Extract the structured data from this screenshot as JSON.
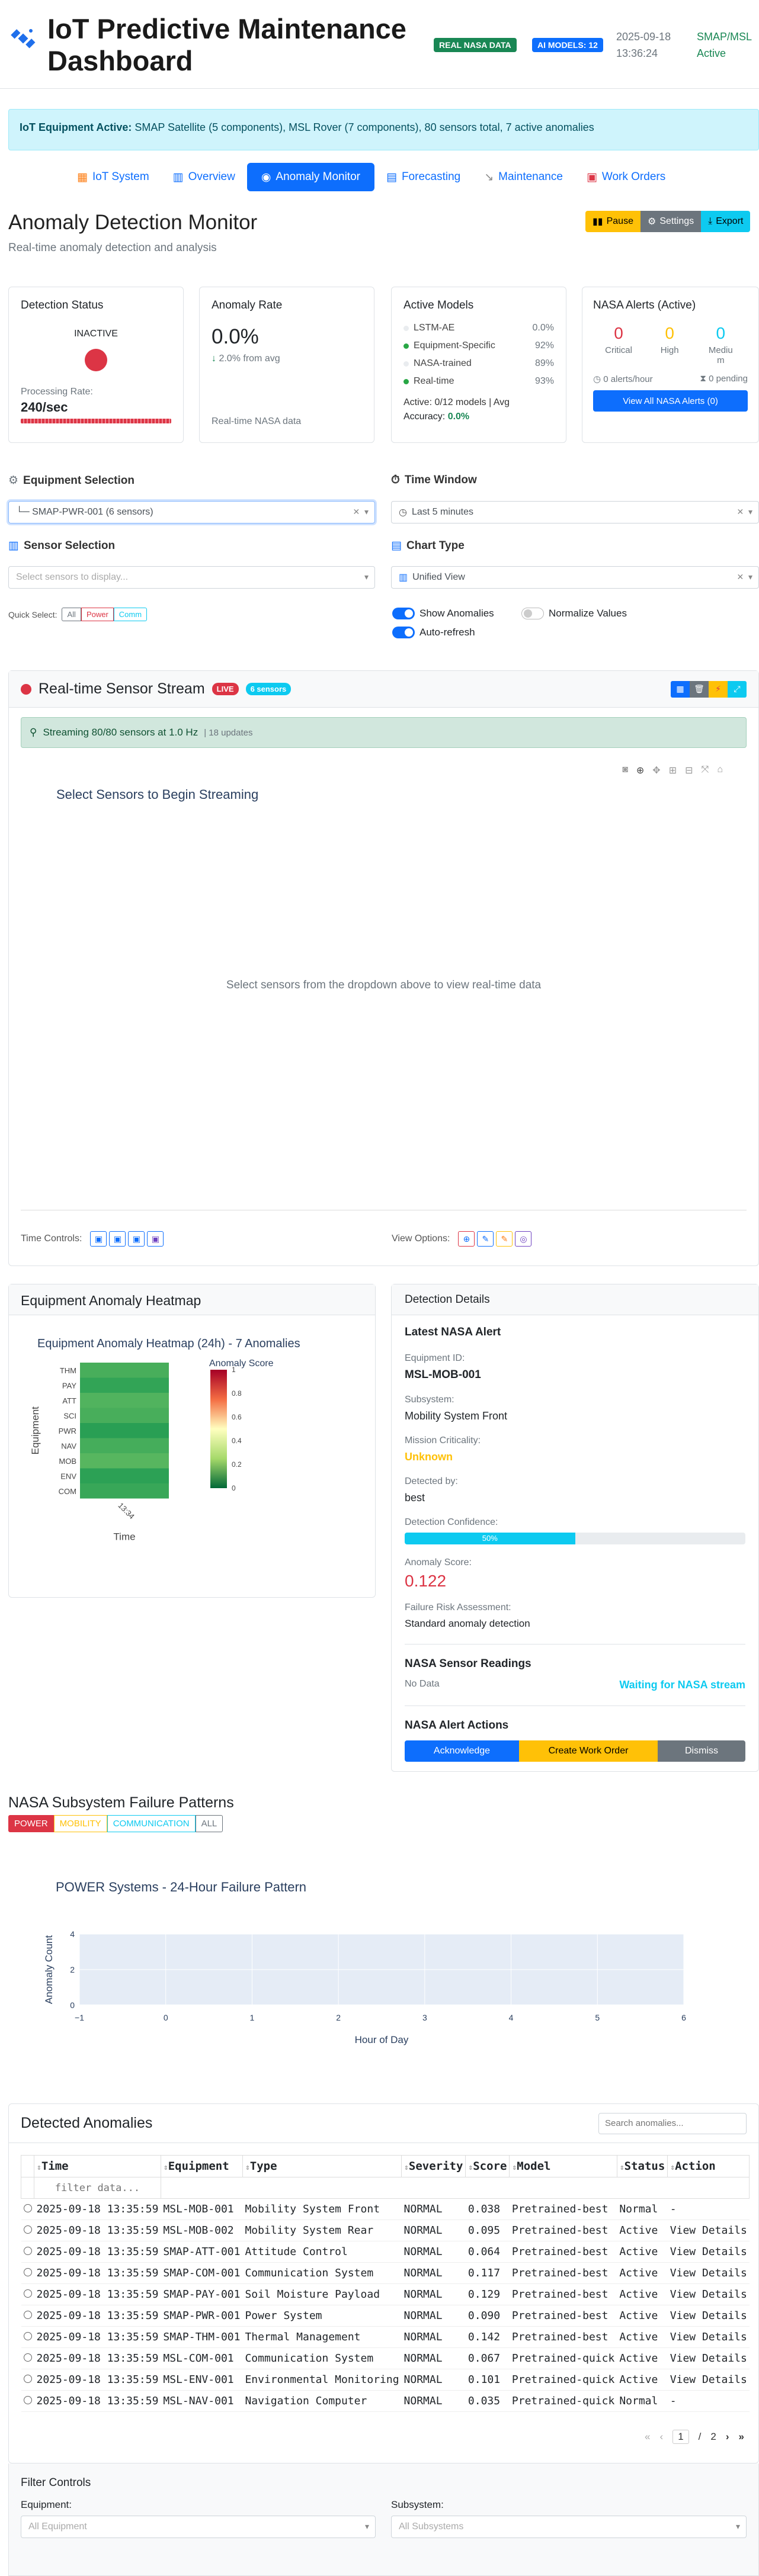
{
  "header": {
    "title_line1": "IoT Predictive Maintenance",
    "title_line2": "Dashboard",
    "badge_real": "REAL NASA DATA",
    "badge_ai": "AI MODELS: 12",
    "date": "2025-09-18",
    "time": "13:36:24",
    "status_line1": "SMAP/MSL",
    "status_line2": "Active"
  },
  "banner": {
    "label": "IoT Equipment Active:",
    "text": " SMAP Satellite (5 components), MSL Rover (7 components), 80 sensors total, 7 active anomalies"
  },
  "nav": {
    "tabs": [
      "IoT System",
      "Overview",
      "Anomaly Monitor",
      "Forecasting",
      "Maintenance",
      "Work Orders"
    ]
  },
  "page": {
    "title": "Anomaly Detection Monitor",
    "subtitle": "Real-time anomaly detection and analysis",
    "pause": "Pause",
    "settings": "Settings",
    "export": "Export"
  },
  "status_cards": {
    "detection": {
      "title": "Detection Status",
      "state": "INACTIVE",
      "rate_label": "Processing Rate:",
      "rate_value": "240/sec"
    },
    "anomaly_rate": {
      "title": "Anomaly Rate",
      "value": "0.0%",
      "delta": "2.0% from avg",
      "footer": "Real-time NASA data"
    },
    "models": {
      "title": "Active Models",
      "items": [
        {
          "name": "LSTM-AE",
          "value": "0.0%",
          "color": "#e9ecef"
        },
        {
          "name": "Equipment-Specific",
          "value": "92%",
          "color": "#28a745"
        },
        {
          "name": "NASA-trained",
          "value": "89%",
          "color": "#e9ecef"
        },
        {
          "name": "Real-time",
          "value": "93%",
          "color": "#28a745"
        }
      ],
      "active_text": "Active: 0/12 models | Avg",
      "accuracy_label": "Accuracy: ",
      "accuracy_value": "0.0%"
    },
    "alerts": {
      "title": "NASA Alerts (Active)",
      "critical_count": "0",
      "critical_label": "Critical",
      "high_count": "0",
      "high_label": "High",
      "medium_count": "0",
      "medium_label_1": "Mediu",
      "medium_label_2": "m",
      "rate": "0 alerts/hour",
      "pending": "0 pending",
      "button": "View All NASA Alerts (0)"
    }
  },
  "controls": {
    "equipment_label": "Equipment Selection",
    "equipment_value": "└─ SMAP-PWR-001 (6 sensors)",
    "time_label": "Time Window",
    "time_value": "Last 5 minutes",
    "sensor_label": "Sensor Selection",
    "sensor_placeholder": "Select sensors to display...",
    "chart_label": "Chart Type",
    "chart_value": "Unified View",
    "quick_select_label": "Quick Select:",
    "quick_all": "All",
    "quick_power": "Power",
    "quick_comm": "Comm",
    "show_anomalies": "Show Anomalies",
    "normalize": "Normalize Values",
    "autorefresh": "Auto-refresh"
  },
  "stream": {
    "title": "Real-time Sensor Stream",
    "live": "LIVE",
    "sensors_badge": "6 sensors",
    "status_text": "Streaming 80/80 sensors at 1.0 Hz",
    "updates": "| 18 updates",
    "chart_title": "Select Sensors to Begin Streaming",
    "empty_msg": "Select sensors from the dropdown above to view real-time data",
    "time_controls": "Time Controls:",
    "view_options": "View Options:"
  },
  "heatmap": {
    "card_title": "Equipment Anomaly Heatmap",
    "chart_title": "Equipment Anomaly Heatmap (24h) - 7 Anomalies",
    "colorbar_title": "Anomaly Score",
    "ylabel": "Equipment",
    "xlabel": "Time",
    "xtick": "13:34"
  },
  "chart_data": {
    "type": "heatmap",
    "title": "Equipment Anomaly Heatmap (24h) - 7 Anomalies",
    "xlabel": "Time",
    "ylabel": "Equipment",
    "x": [
      "13:34"
    ],
    "categories": [
      "THM",
      "PAY",
      "ATT",
      "SCI",
      "PWR",
      "NAV",
      "MOB",
      "ENV",
      "COM"
    ],
    "values": [
      0.15,
      0.08,
      0.18,
      0.15,
      0.05,
      0.14,
      0.2,
      0.06,
      0.1
    ],
    "colorbar_ticks": [
      "1",
      "0.8",
      "0.6",
      "0.4",
      "0.2",
      "0"
    ],
    "zlim": [
      0,
      1
    ]
  },
  "details": {
    "card_title": "Detection Details",
    "latest_title": "Latest NASA Alert",
    "equipment_id_label": "Equipment ID:",
    "equipment_id": "MSL-MOB-001",
    "subsystem_label": "Subsystem:",
    "subsystem": "Mobility System Front",
    "criticality_label": "Mission Criticality:",
    "criticality": "Unknown",
    "detected_label": "Detected by:",
    "detected": "best",
    "confidence_label": "Detection Confidence:",
    "confidence_text": "50%",
    "confidence_value": 50,
    "score_label": "Anomaly Score:",
    "score": "0.122",
    "risk_label": "Failure Risk Assessment:",
    "risk": "Standard anomaly detection",
    "readings_title": "NASA Sensor Readings",
    "no_data": "No Data",
    "waiting": "Waiting for NASA stream",
    "actions_title": "NASA Alert Actions",
    "acknowledge": "Acknowledge",
    "create_wo": "Create Work Order",
    "dismiss": "Dismiss"
  },
  "failure": {
    "title": "NASA Subsystem Failure Patterns",
    "tabs": [
      "POWER",
      "MOBILITY",
      "COMMUNICATION",
      "ALL"
    ],
    "chart_title": "POWER Systems - 24-Hour Failure Pattern",
    "ylabel": "Anomaly Count",
    "xlabel": "Hour of Day",
    "xticks": [
      "−1",
      "0",
      "1",
      "2",
      "3",
      "4",
      "5",
      "6"
    ],
    "yticks": [
      "4",
      "2",
      "0"
    ]
  },
  "anomalies": {
    "title": "Detected Anomalies",
    "search_placeholder": "Search anomalies...",
    "filter_placeholder": "filter data...",
    "columns": [
      "Time",
      "Equipment",
      "Type",
      "Severity",
      "Score",
      "Model",
      "Status",
      "Action"
    ],
    "rows": [
      [
        "2025-09-18 13:35:59",
        "MSL-MOB-001",
        "Mobility System Front",
        "NORMAL",
        "0.038",
        "Pretrained-best",
        "Normal",
        "-"
      ],
      [
        "2025-09-18 13:35:59",
        "MSL-MOB-002",
        "Mobility System Rear",
        "NORMAL",
        "0.095",
        "Pretrained-best",
        "Active",
        "View Details"
      ],
      [
        "2025-09-18 13:35:59",
        "SMAP-ATT-001",
        "Attitude Control",
        "NORMAL",
        "0.064",
        "Pretrained-best",
        "Active",
        "View Details"
      ],
      [
        "2025-09-18 13:35:59",
        "SMAP-COM-001",
        "Communication System",
        "NORMAL",
        "0.117",
        "Pretrained-best",
        "Active",
        "View Details"
      ],
      [
        "2025-09-18 13:35:59",
        "SMAP-PAY-001",
        "Soil Moisture Payload",
        "NORMAL",
        "0.129",
        "Pretrained-best",
        "Active",
        "View Details"
      ],
      [
        "2025-09-18 13:35:59",
        "SMAP-PWR-001",
        "Power System",
        "NORMAL",
        "0.090",
        "Pretrained-best",
        "Active",
        "View Details"
      ],
      [
        "2025-09-18 13:35:59",
        "SMAP-THM-001",
        "Thermal Management",
        "NORMAL",
        "0.142",
        "Pretrained-best",
        "Active",
        "View Details"
      ],
      [
        "2025-09-18 13:35:59",
        "MSL-COM-001",
        "Communication System",
        "NORMAL",
        "0.067",
        "Pretrained-quick",
        "Active",
        "View Details"
      ],
      [
        "2025-09-18 13:35:59",
        "MSL-ENV-001",
        "Environmental Monitoring",
        "NORMAL",
        "0.101",
        "Pretrained-quick",
        "Active",
        "View Details"
      ],
      [
        "2025-09-18 13:35:59",
        "MSL-NAV-001",
        "Navigation Computer",
        "NORMAL",
        "0.035",
        "Pretrained-quick",
        "Normal",
        "-"
      ]
    ],
    "page_current": "1",
    "page_sep": "/",
    "page_total": "2"
  },
  "filters": {
    "title": "Filter Controls",
    "equipment_label": "Equipment:",
    "equipment_placeholder": "All Equipment",
    "subsystem_label": "Subsystem:",
    "subsystem_placeholder": "All Subsystems"
  }
}
